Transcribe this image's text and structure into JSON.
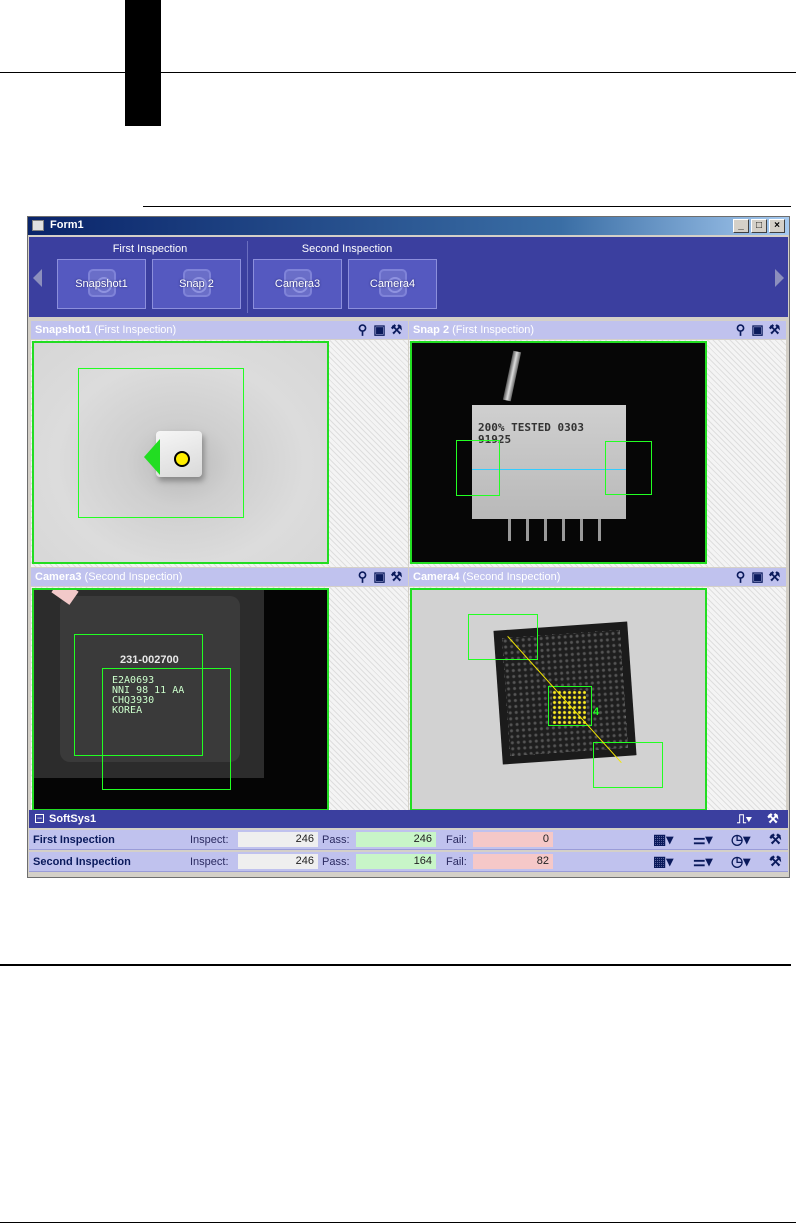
{
  "window": {
    "title": "Form1"
  },
  "ribbon": {
    "groups": [
      {
        "label": "First Inspection",
        "buttons": [
          "Snapshot1",
          "Snap 2"
        ]
      },
      {
        "label": "Second Inspection",
        "buttons": [
          "Camera3",
          "Camera4"
        ]
      }
    ]
  },
  "panels": [
    {
      "name": "Snapshot1",
      "inspection": "(First Inspection)"
    },
    {
      "name": "Snap 2",
      "inspection": "(First Inspection)",
      "image_text": [
        "200% TESTED 0303",
        "91925"
      ]
    },
    {
      "name": "Camera3",
      "inspection": "(Second Inspection)",
      "image_text": [
        "231-002700",
        "E2A0693",
        "NNI 98 11 AA",
        "CHQ3930",
        "KOREA"
      ]
    },
    {
      "name": "Camera4",
      "inspection": "(Second Inspection)",
      "image_text": [
        "4"
      ]
    }
  ],
  "status": {
    "system_name": "SoftSys1",
    "rows": [
      {
        "name": "First Inspection",
        "inspect_label": "Inspect:",
        "inspect": "246",
        "pass_label": "Pass:",
        "pass": "246",
        "fail_label": "Fail:",
        "fail": "0"
      },
      {
        "name": "Second Inspection",
        "inspect_label": "Inspect:",
        "inspect": "246",
        "pass_label": "Pass:",
        "pass": "164",
        "fail_label": "Fail:",
        "fail": "82"
      }
    ]
  },
  "colors": {
    "ribbon": "#3b3f9f",
    "panel_header": "#c0c2ee",
    "roi": "#22ff22",
    "pass_bg": "#c8f5c8",
    "fail_bg": "#f5c8c8"
  },
  "icons": [
    "zoom-icon",
    "save-icon",
    "tools-icon",
    "pulse-icon",
    "grid-icon",
    "filter-icon",
    "timer-icon"
  ]
}
